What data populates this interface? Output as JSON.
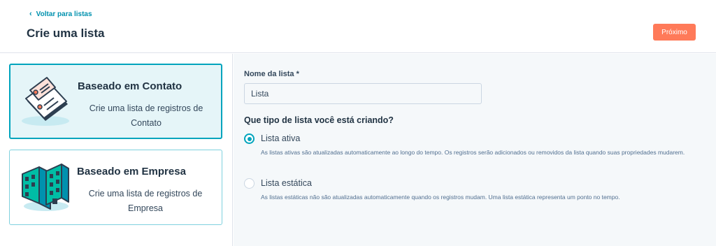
{
  "header": {
    "back_label": "Voltar para listas",
    "title": "Crie uma lista",
    "next_button": "Próximo"
  },
  "cards": [
    {
      "title": "Baseado em Contato",
      "description": "Crie uma lista de registros de Contato",
      "selected": true
    },
    {
      "title": "Baseado em Empresa",
      "description": "Crie uma lista de registros de Empresa",
      "selected": false
    }
  ],
  "form": {
    "name_label": "Nome da lista *",
    "name_value": "Lista",
    "question": "Que tipo de lista você está criando?",
    "options": [
      {
        "label": "Lista ativa",
        "help": "As listas ativas são atualizadas automaticamente ao longo do tempo. Os registros serão adicionados ou removidos da lista quando suas propriedades mudarem.",
        "checked": true
      },
      {
        "label": "Lista estática",
        "help": "As listas estáticas não são atualizadas automaticamente quando os registros mudam. Uma lista estática representa um ponto no tempo.",
        "checked": false
      }
    ]
  },
  "colors": {
    "accent": "#00a4bd",
    "primary_button": "#ff7a59",
    "link": "#0091ae"
  },
  "icons": {
    "back": "chevron-left-icon",
    "contact": "contact-cards-illustration",
    "company": "company-buildings-illustration"
  }
}
